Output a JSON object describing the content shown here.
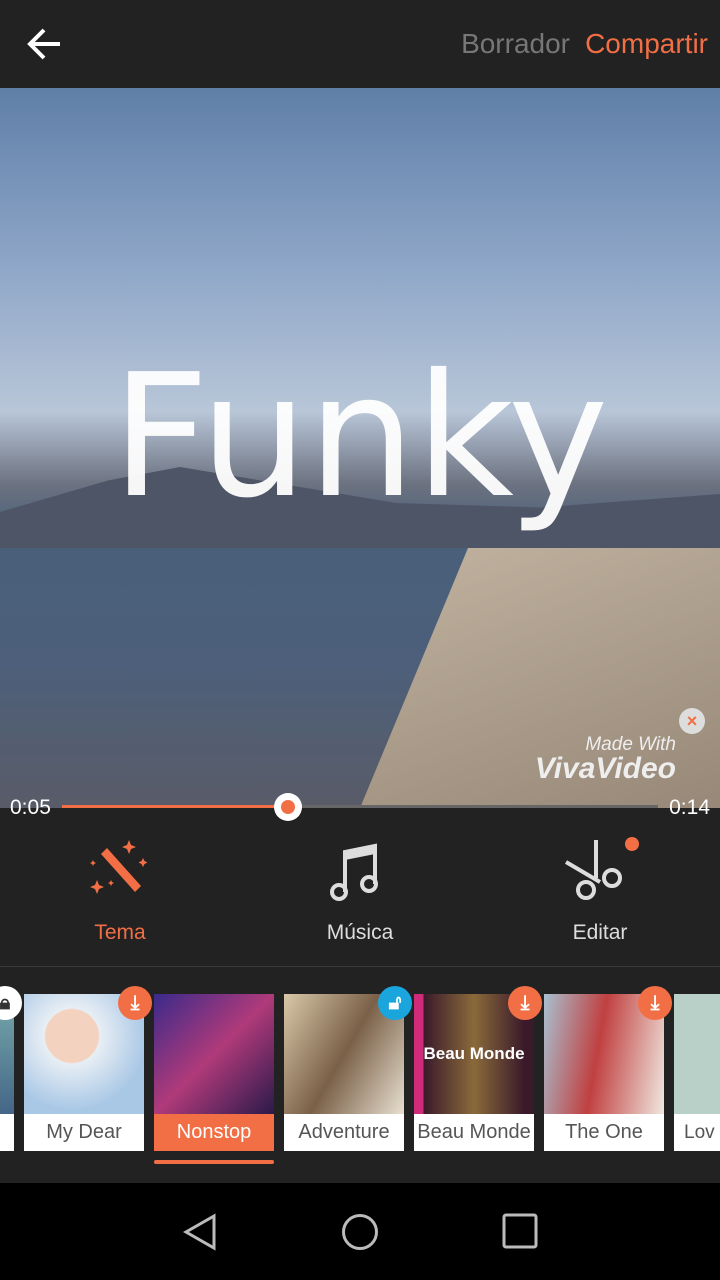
{
  "header": {
    "draft_label": "Borrador",
    "share_label": "Compartir",
    "back_icon": "arrow-left-icon"
  },
  "video": {
    "title_text": "Funky",
    "watermark_line1": "Made With",
    "watermark_line2": "VivaVideo",
    "watermark_close": "×"
  },
  "player": {
    "current_time": "0:05",
    "total_time": "0:14",
    "progress": 0.38
  },
  "tools": [
    {
      "label": "Tema",
      "icon": "magic-wand-icon",
      "active": true
    },
    {
      "label": "Música",
      "icon": "music-note-icon",
      "active": false
    },
    {
      "label": "Editar",
      "icon": "scissors-icon",
      "active": false,
      "dot": true
    }
  ],
  "themes": [
    {
      "name": "",
      "badge": "lock"
    },
    {
      "name": "My Dear",
      "badge": "download"
    },
    {
      "name": "Nonstop",
      "badge": "",
      "selected": true
    },
    {
      "name": "Adventure",
      "badge": "lock"
    },
    {
      "name": "Beau Monde",
      "badge": "download",
      "overlay": "Beau Monde"
    },
    {
      "name": "The One",
      "badge": "download"
    },
    {
      "name": "Lov",
      "badge": ""
    }
  ],
  "colors": {
    "accent": "#f26f45",
    "lock": "#1aa6dc",
    "background": "#222222"
  }
}
